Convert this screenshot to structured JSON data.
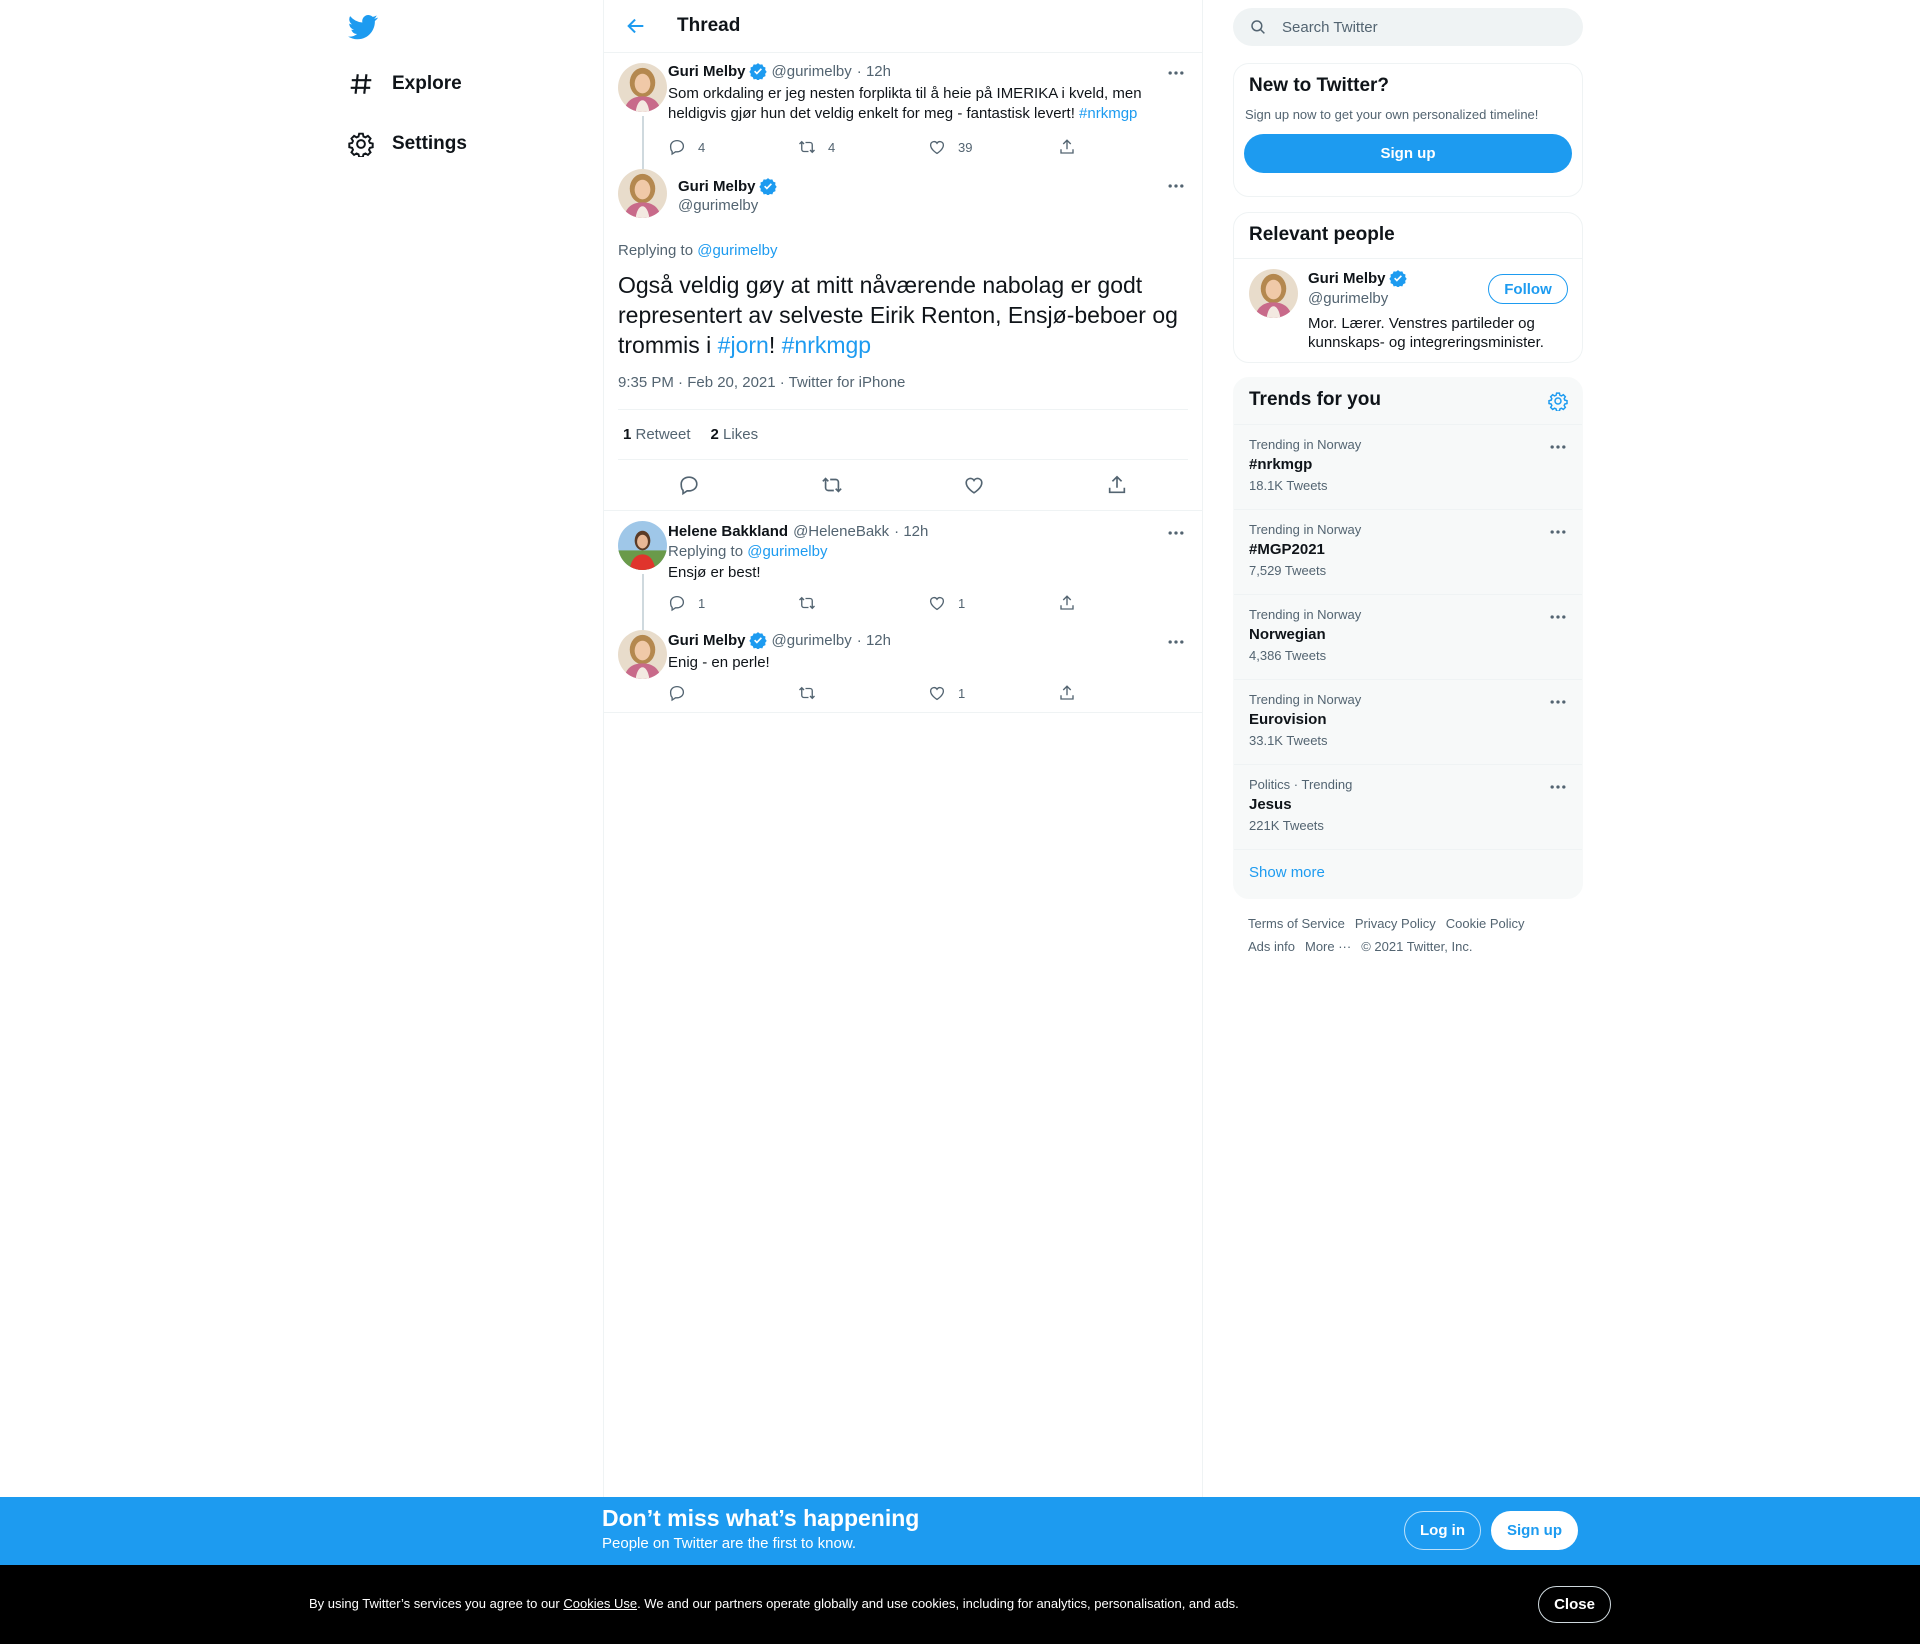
{
  "nav": {
    "items": [
      {
        "label": "Explore",
        "icon": "hashtag-icon"
      },
      {
        "label": "Settings",
        "icon": "gear-icon"
      }
    ]
  },
  "header": {
    "title": "Thread"
  },
  "tweets": [
    {
      "name": "Guri Melby",
      "handle": "@gurimelby",
      "time": "· 12h",
      "text": "Som orkdaling er jeg nesten forplikta til å heie på IMERIKA i kveld, men heldigvis gjør hun det veldig enkelt for meg - fantastisk levert! ",
      "hashtag": "#nrkmgp",
      "replies": "4",
      "retweets": "4",
      "likes": "39"
    }
  ],
  "main_tweet": {
    "name": "Guri Melby",
    "handle": "@gurimelby",
    "replying_label": "Replying to ",
    "replying_handle": "@gurimelby",
    "text": "Også veldig gøy at mitt nåværende nabolag er godt representert av selveste Eirik Renton, Ensjø-beboer og trommis i ",
    "hashtag1": "#jorn",
    "sep": "! ",
    "hashtag2": "#nrkmgp",
    "meta": "9:35 PM · Feb 20, 2021 · Twitter for iPhone",
    "retweet_count": "1",
    "retweet_label": " Retweet",
    "like_count": "2",
    "like_label": " Likes"
  },
  "replies": [
    {
      "name": "Helene Bakkland",
      "handle": "@HeleneBakk",
      "time": "· 12h",
      "replying_label": "Replying to ",
      "replying_handle": "@gurimelby",
      "text": "Ensjø er best!",
      "replies": "1",
      "retweets": "",
      "likes": "1"
    },
    {
      "name": "Guri Melby",
      "handle": "@gurimelby",
      "time": "· 12h",
      "text": "Enig - en perle!",
      "replies": "",
      "retweets": "",
      "likes": "1"
    }
  ],
  "search": {
    "placeholder": "Search Twitter"
  },
  "new_to_twitter": {
    "title": "New to Twitter?",
    "subtitle": "Sign up now to get your own personalized timeline!",
    "button": "Sign up"
  },
  "relevant_people": {
    "title": "Relevant people",
    "name": "Guri Melby",
    "handle": "@gurimelby",
    "follow": "Follow",
    "bio": "Mor. Lærer. Venstres partileder og kunnskaps- og integreringsminister."
  },
  "trends": {
    "title": "Trends for you",
    "items": [
      {
        "context": "Trending in Norway",
        "name": "#nrkmgp",
        "count": "18.1K Tweets"
      },
      {
        "context": "Trending in Norway",
        "name": "#MGP2021",
        "count": "7,529 Tweets"
      },
      {
        "context": "Trending in Norway",
        "name": "Norwegian",
        "count": "4,386 Tweets"
      },
      {
        "context": "Trending in Norway",
        "name": "Eurovision",
        "count": "33.1K Tweets"
      },
      {
        "context": "Politics · Trending",
        "name": "Jesus",
        "count": "221K Tweets"
      }
    ],
    "show_more": "Show more"
  },
  "footer": {
    "links": [
      "Terms of Service",
      "Privacy Policy",
      "Cookie Policy",
      "Ads info",
      "More ···"
    ],
    "copyright": "© 2021 Twitter, Inc."
  },
  "bottom_bar": {
    "title": "Don’t miss what’s happening",
    "subtitle": "People on Twitter are the first to know.",
    "login": "Log in",
    "signup": "Sign up"
  },
  "cookie": {
    "pre": "By using Twitter’s services you agree to our ",
    "link": "Cookies Use",
    "post": ". We and our partners operate globally and use cookies, including for analytics, personalisation, and ads.",
    "close": "Close"
  },
  "colors": {
    "accent": "#1d9bf0",
    "text": "#0f1419",
    "muted": "#536471",
    "border": "#eff3f4"
  }
}
